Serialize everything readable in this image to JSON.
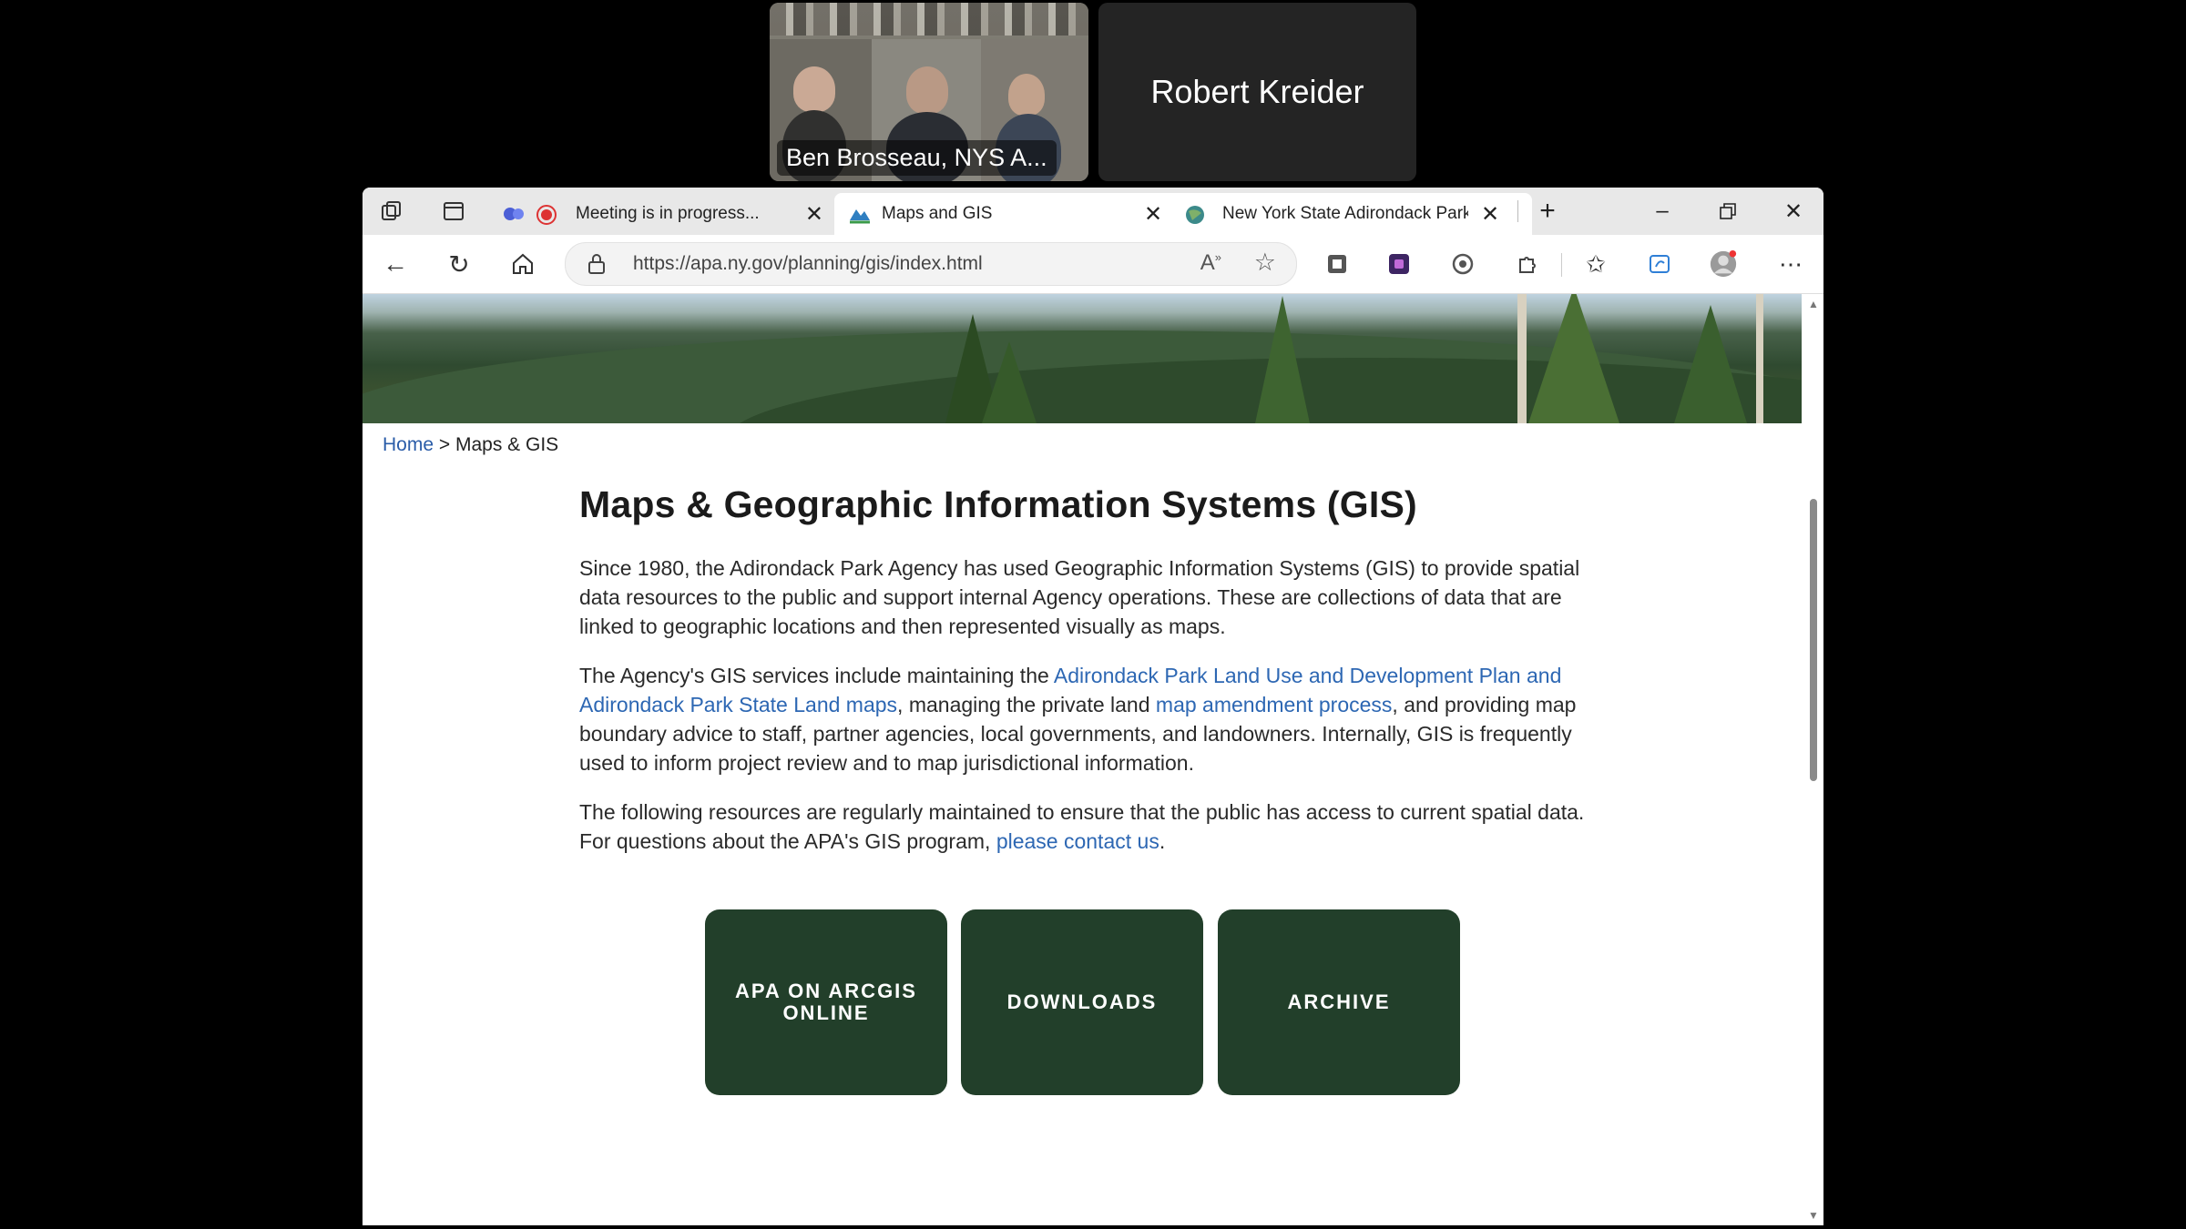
{
  "meeting": {
    "tiles": [
      {
        "name": "Ben Brosseau, NYS A..."
      },
      {
        "name": "Robert Kreider"
      }
    ]
  },
  "browser": {
    "tabs": [
      {
        "label": "Meeting is in progress...",
        "active": false
      },
      {
        "label": "Maps and GIS",
        "active": true
      },
      {
        "label": "New York State Adirondack Park",
        "active": false
      }
    ],
    "url": "https://apa.ny.gov/planning/gis/index.html"
  },
  "page": {
    "breadcrumb": {
      "home": "Home",
      "separator": ">",
      "current": "Maps & GIS"
    },
    "title": "Maps & Geographic Information Systems (GIS)",
    "para1": "Since 1980, the Adirondack Park Agency has used Geographic Information Systems (GIS) to provide spatial data resources to the public and support internal Agency operations. These are collections of data that are linked to geographic locations and then represented visually as maps.",
    "para2": {
      "t1": "The Agency's GIS services include maintaining the ",
      "link1": "Adirondack Park Land Use and Development Plan and Adirondack Park State Land maps",
      "t2": ", managing the private land ",
      "link2": "map amendment process",
      "t3": ", and providing map boundary advice to staff, partner agencies, local governments, and landowners. Internally, GIS is frequently used to inform project review and to map jurisdictional information."
    },
    "para3": {
      "t1": "The following resources are regularly maintained to ensure that the public has access to current spatial data. For questions about the APA's GIS program, ",
      "link": "please contact us",
      "t2": "."
    },
    "buttons": [
      {
        "label": "APA ON ARCGIS ONLINE"
      },
      {
        "label": "DOWNLOADS"
      },
      {
        "label": "ARCHIVE"
      }
    ]
  },
  "colors": {
    "button_bg": "#223f2a",
    "link": "#2d67b3"
  }
}
